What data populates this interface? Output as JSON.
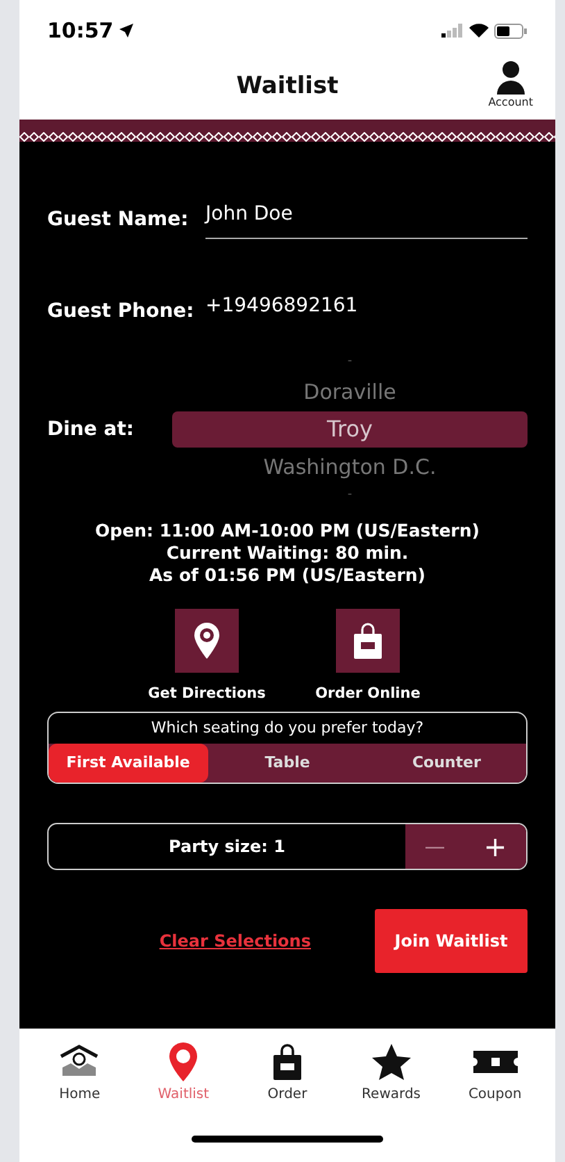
{
  "status_bar": {
    "time": "10:57"
  },
  "header": {
    "title": "Waitlist",
    "account_label": "Account"
  },
  "form": {
    "fields": [
      {
        "label": "Guest Name:",
        "value": "John Doe",
        "underlined": true
      },
      {
        "label": "Guest Phone:",
        "value": "+19496892161",
        "underlined": false
      }
    ],
    "dine_at": {
      "label": "Dine at:",
      "options": [
        {
          "text": "-",
          "selected": false
        },
        {
          "text": "Doraville",
          "selected": false
        },
        {
          "text": "Troy",
          "selected": true
        },
        {
          "text": "Washington D.C.",
          "selected": false
        },
        {
          "text": "-",
          "selected": false
        }
      ]
    },
    "info": [
      "Open: 11:00 AM-10:00 PM (US/Eastern)",
      "Current Waiting: 80 min.",
      "As of 01:56 PM (US/Eastern)"
    ],
    "actions": [
      {
        "kind": "directions",
        "label": "Get Directions"
      },
      {
        "kind": "order",
        "label": "Order Online"
      }
    ],
    "seating": {
      "question": "Which seating do you prefer today?",
      "options": [
        {
          "label": "First Available",
          "selected": true
        },
        {
          "label": "Table",
          "selected": false
        },
        {
          "label": "Counter",
          "selected": false
        }
      ]
    },
    "party": {
      "label": "Party size: 1",
      "minus": "—",
      "plus": "+"
    },
    "clear": "Clear Selections",
    "join": "Join Waitlist"
  },
  "tab_bar": [
    {
      "kind": "home",
      "label": "Home",
      "selected": false
    },
    {
      "kind": "pin",
      "label": "Waitlist",
      "selected": true
    },
    {
      "kind": "bag",
      "label": "Order",
      "selected": false
    },
    {
      "kind": "star",
      "label": "Rewards",
      "selected": false
    },
    {
      "kind": "coupon",
      "label": "Coupon",
      "selected": false
    }
  ]
}
